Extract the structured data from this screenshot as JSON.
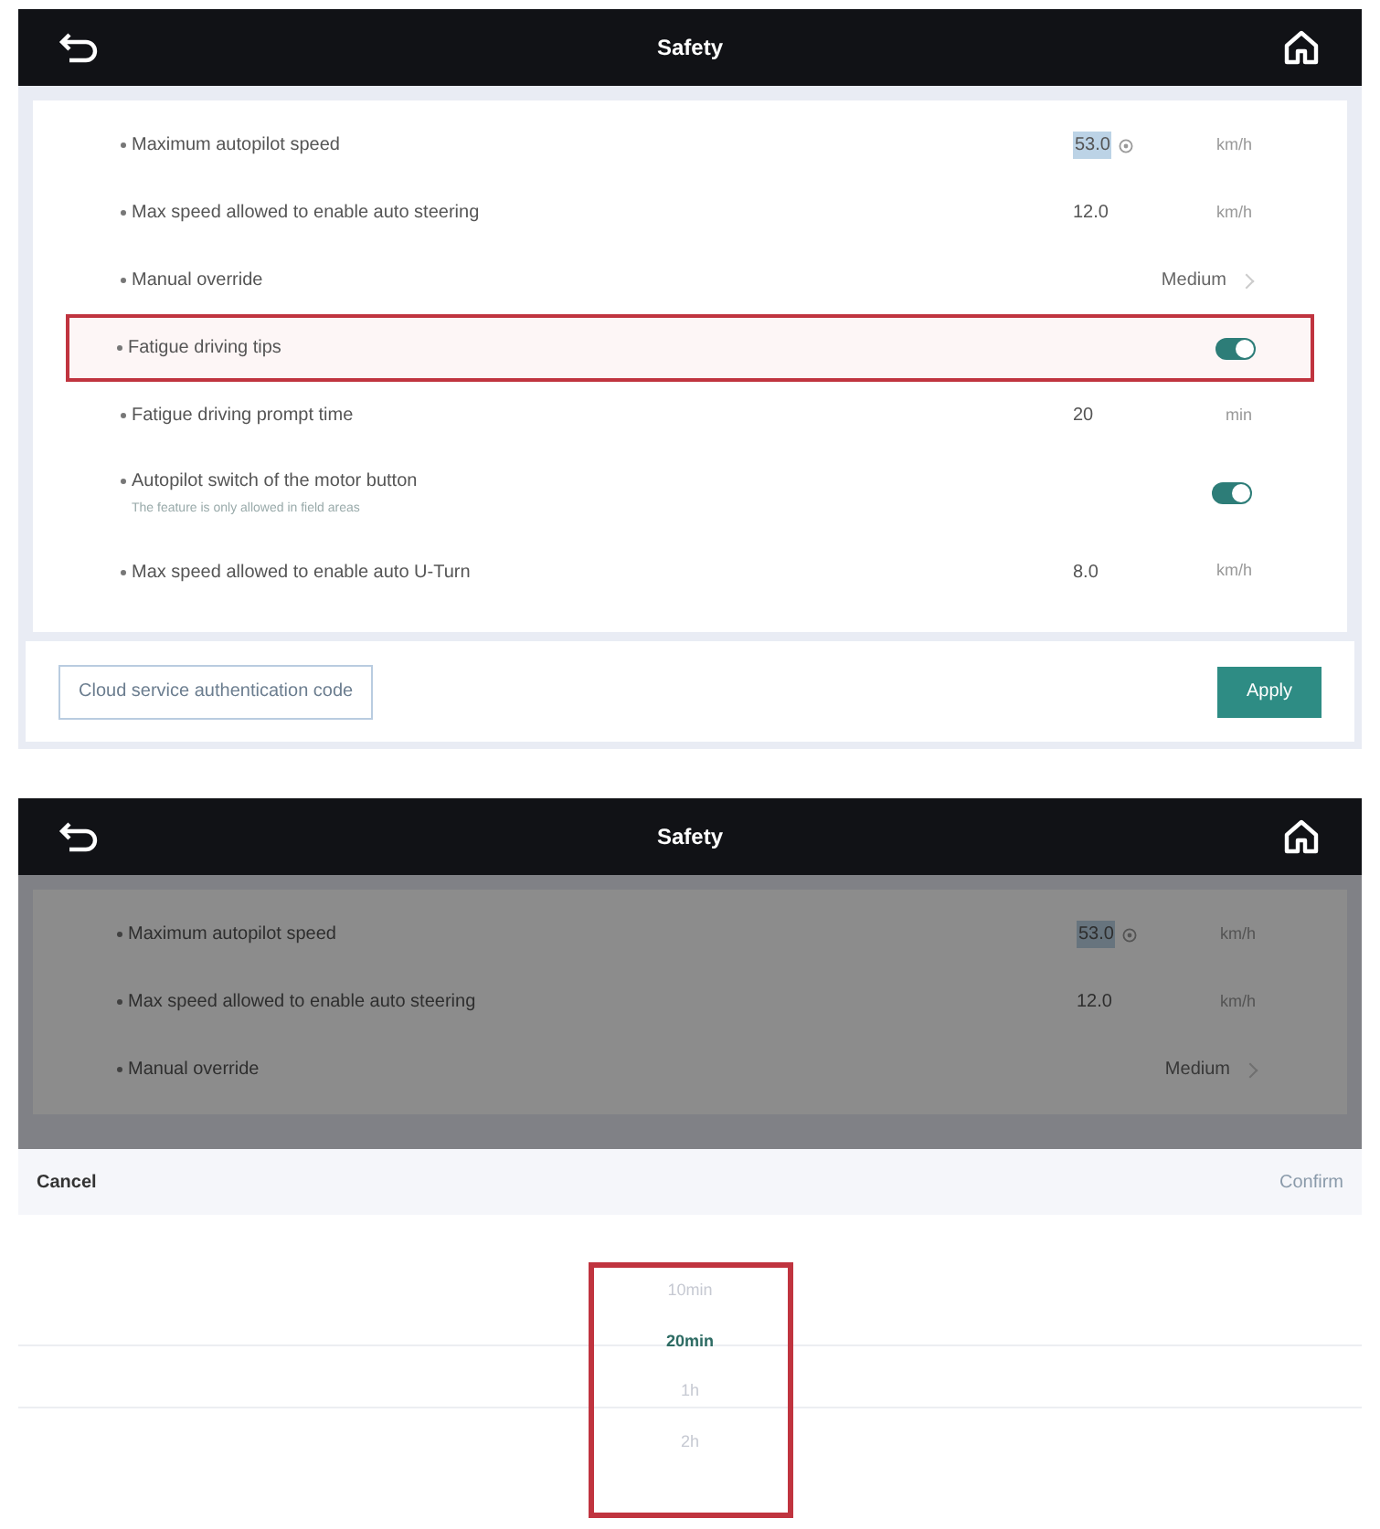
{
  "settings_screen": {
    "title": "Safety",
    "rows": [
      {
        "kind": "value",
        "label": "Maximum autopilot speed",
        "value": "53.0",
        "focused": true,
        "unit": "km/h",
        "highlighted": false
      },
      {
        "kind": "value",
        "label": "Max speed allowed to enable auto steering",
        "value": "12.0",
        "focused": false,
        "unit": "km/h",
        "highlighted": false
      },
      {
        "kind": "select",
        "label": "Manual override",
        "value": "Medium",
        "highlighted": false
      },
      {
        "kind": "toggle",
        "label": "Fatigue driving tips",
        "on": true,
        "highlighted": true
      },
      {
        "kind": "value",
        "label": "Fatigue driving prompt time",
        "value": "20",
        "focused": false,
        "unit": "min",
        "highlighted": false
      },
      {
        "kind": "toggle",
        "label": "Autopilot switch of the motor button",
        "subtitle": "The feature is only allowed in field areas",
        "on": true,
        "highlighted": false
      },
      {
        "kind": "value",
        "label": "Max speed allowed to enable auto U-Turn",
        "value": "8.0",
        "focused": false,
        "unit": "km/h",
        "highlighted": false
      }
    ],
    "auth_button": "Cloud service authentication code",
    "apply_button": "Apply"
  },
  "picker_screen": {
    "title": "Safety",
    "rows": [
      {
        "kind": "value",
        "label": "Maximum autopilot speed",
        "value": "53.0",
        "focused": true,
        "unit": "km/h"
      },
      {
        "kind": "value",
        "label": "Max speed allowed to enable auto steering",
        "value": "12.0",
        "focused": false,
        "unit": "km/h"
      },
      {
        "kind": "select",
        "label": "Manual override",
        "value": "Medium"
      }
    ],
    "cancel": "Cancel",
    "confirm": "Confirm",
    "highlighted": true,
    "options": [
      {
        "label": "10min",
        "selected": false
      },
      {
        "label": "20min",
        "selected": true
      },
      {
        "label": "1h",
        "selected": false
      },
      {
        "label": "2h",
        "selected": false
      }
    ]
  }
}
